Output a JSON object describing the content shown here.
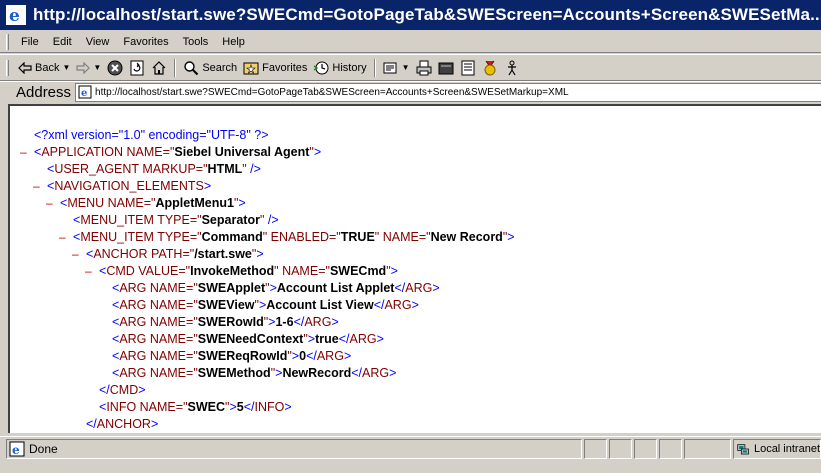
{
  "window": {
    "title": "http://localhost/start.swe?SWECmd=GotoPageTab&SWEScreen=Accounts+Screen&SWESetMa..."
  },
  "menubar": {
    "items": [
      "File",
      "Edit",
      "View",
      "Favorites",
      "Tools",
      "Help"
    ]
  },
  "toolbar": {
    "back_label": "Back",
    "search_label": "Search",
    "favorites_label": "Favorites",
    "history_label": "History"
  },
  "address": {
    "label": "Address",
    "value": "http://localhost/start.swe?SWECmd=GotoPageTab&SWEScreen=Accounts+Screen&SWESetMarkup=XML"
  },
  "xml": {
    "declaration": "<?xml version=\"1.0\" encoding=\"UTF-8\" ?>",
    "lines": [
      {
        "indent": 0,
        "collapsible": true,
        "open": "APPLICATION",
        "attrs": [
          [
            "NAME",
            "Siebel Universal Agent"
          ]
        ],
        "self_closing": false
      },
      {
        "indent": 1,
        "collapsible": false,
        "open": "USER_AGENT",
        "attrs": [
          [
            "MARKUP",
            "HTML"
          ]
        ],
        "self_closing": true
      },
      {
        "indent": 1,
        "collapsible": true,
        "open": "NAVIGATION_ELEMENTS",
        "attrs": [],
        "self_closing": false
      },
      {
        "indent": 2,
        "collapsible": true,
        "open": "MENU",
        "attrs": [
          [
            "NAME",
            "AppletMenu1"
          ]
        ],
        "self_closing": false
      },
      {
        "indent": 3,
        "collapsible": false,
        "open": "MENU_ITEM",
        "attrs": [
          [
            "TYPE",
            "Separator"
          ]
        ],
        "self_closing": true
      },
      {
        "indent": 3,
        "collapsible": true,
        "open": "MENU_ITEM",
        "attrs": [
          [
            "TYPE",
            "Command"
          ],
          [
            "ENABLED",
            "TRUE"
          ],
          [
            "NAME",
            "New Record"
          ]
        ],
        "self_closing": false
      },
      {
        "indent": 4,
        "collapsible": true,
        "open": "ANCHOR",
        "attrs": [
          [
            "PATH",
            "/start.swe"
          ]
        ],
        "self_closing": false
      },
      {
        "indent": 5,
        "collapsible": true,
        "open": "CMD",
        "attrs": [
          [
            "VALUE",
            "InvokeMethod"
          ],
          [
            "NAME",
            "SWECmd"
          ]
        ],
        "self_closing": false
      },
      {
        "indent": 6,
        "collapsible": false,
        "open": "ARG",
        "attrs": [
          [
            "NAME",
            "SWEApplet"
          ]
        ],
        "text": "Account List Applet"
      },
      {
        "indent": 6,
        "collapsible": false,
        "open": "ARG",
        "attrs": [
          [
            "NAME",
            "SWEView"
          ]
        ],
        "text": "Account List View"
      },
      {
        "indent": 6,
        "collapsible": false,
        "open": "ARG",
        "attrs": [
          [
            "NAME",
            "SWERowId"
          ]
        ],
        "text": "1-6"
      },
      {
        "indent": 6,
        "collapsible": false,
        "open": "ARG",
        "attrs": [
          [
            "NAME",
            "SWENeedContext"
          ]
        ],
        "text": "true"
      },
      {
        "indent": 6,
        "collapsible": false,
        "open": "ARG",
        "attrs": [
          [
            "NAME",
            "SWEReqRowId"
          ]
        ],
        "text": "0"
      },
      {
        "indent": 6,
        "collapsible": false,
        "open": "ARG",
        "attrs": [
          [
            "NAME",
            "SWEMethod"
          ]
        ],
        "text": "NewRecord"
      },
      {
        "indent": 5,
        "collapsible": false,
        "close": "CMD"
      },
      {
        "indent": 5,
        "collapsible": false,
        "open": "INFO",
        "attrs": [
          [
            "NAME",
            "SWEC"
          ]
        ],
        "text": "5"
      },
      {
        "indent": 4,
        "collapsible": false,
        "close": "ANCHOR"
      }
    ]
  },
  "status": {
    "text": "Done",
    "zone": "Local intranet"
  },
  "colors": {
    "titlebar": "#0a246a",
    "tag": "#800000",
    "markup_blue": "#0000ff",
    "collapse_minus": "#c00000"
  }
}
